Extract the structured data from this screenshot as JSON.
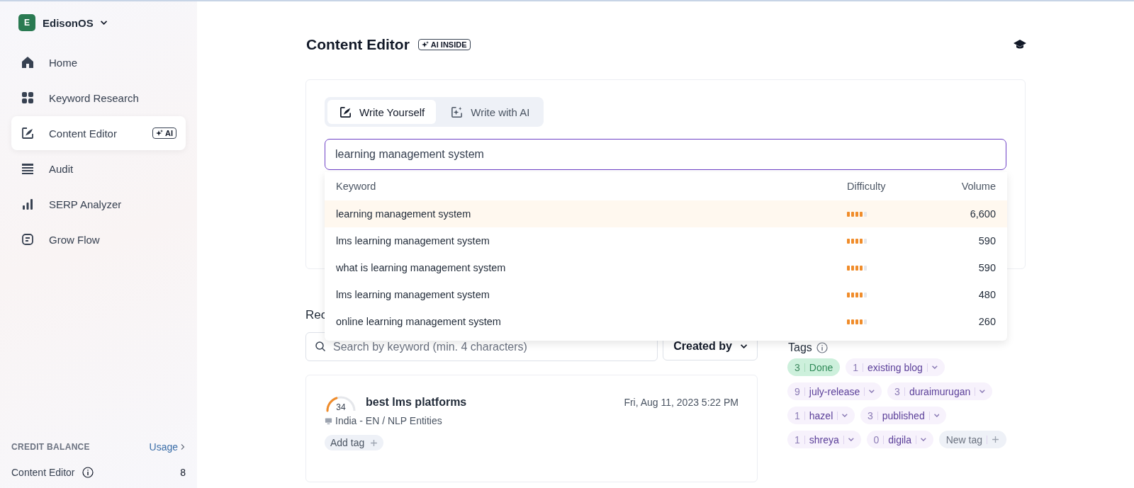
{
  "workspace": {
    "initial": "E",
    "name": "EdisonOS"
  },
  "sidebar": {
    "items": [
      {
        "label": "Home",
        "selected": false
      },
      {
        "label": "Keyword Research",
        "selected": false
      },
      {
        "label": "Content Editor",
        "selected": true,
        "badge": "AI"
      },
      {
        "label": "Audit",
        "selected": false
      },
      {
        "label": "SERP Analyzer",
        "selected": false
      },
      {
        "label": "Grow Flow",
        "selected": false
      }
    ]
  },
  "credit": {
    "heading": "CREDIT BALANCE",
    "link": "Usage",
    "label": "Content Editor",
    "value": "8"
  },
  "page": {
    "title": "Content Editor",
    "badge": "AI INSIDE"
  },
  "mode_tabs": [
    {
      "label": "Write Yourself",
      "selected": true
    },
    {
      "label": "Write with AI",
      "selected": false
    }
  ],
  "keyword_input": {
    "value": "learning management system"
  },
  "suggestions": {
    "columns": [
      "Keyword",
      "Difficulty",
      "Volume"
    ],
    "rows": [
      {
        "keyword": "learning management system",
        "level": 0.8,
        "volume": "6,600",
        "selected": true
      },
      {
        "keyword": "lms learning management system",
        "level": 0.8,
        "volume": "590",
        "selected": false
      },
      {
        "keyword": "what is learning management system",
        "level": 0.8,
        "volume": "590",
        "selected": false
      },
      {
        "keyword": "lms learning management system",
        "level": 0.8,
        "volume": "480",
        "selected": false
      },
      {
        "keyword": "online learning management system",
        "level": 0.8,
        "volume": "260",
        "selected": false
      }
    ]
  },
  "recent": {
    "heading": "Rec",
    "search": {
      "placeholder": "Search by keyword (min. 4 characters)"
    },
    "filter": "Created by",
    "docs": [
      {
        "score": "34",
        "level": 0.34,
        "title": "best lms platforms",
        "date": "Fri, Aug 11, 2023 5:22 PM",
        "meta": "India - EN / NLP Entities",
        "add_tag": "Add tag"
      }
    ]
  },
  "tags": {
    "heading": "Tags",
    "items": [
      {
        "kind": "status",
        "count": "3",
        "label": "Done"
      },
      {
        "kind": "tag",
        "count": "1",
        "label": "existing blog"
      },
      {
        "kind": "tag",
        "count": "9",
        "label": "july-release"
      },
      {
        "kind": "tag",
        "count": "3",
        "label": "duraimurugan"
      },
      {
        "kind": "tag",
        "count": "1",
        "label": "hazel"
      },
      {
        "kind": "tag",
        "count": "3",
        "label": "published"
      },
      {
        "kind": "tag",
        "count": "1",
        "label": "shreya"
      },
      {
        "kind": "tag",
        "count": "0",
        "label": "digila"
      },
      {
        "kind": "new",
        "label": "New tag"
      }
    ]
  }
}
